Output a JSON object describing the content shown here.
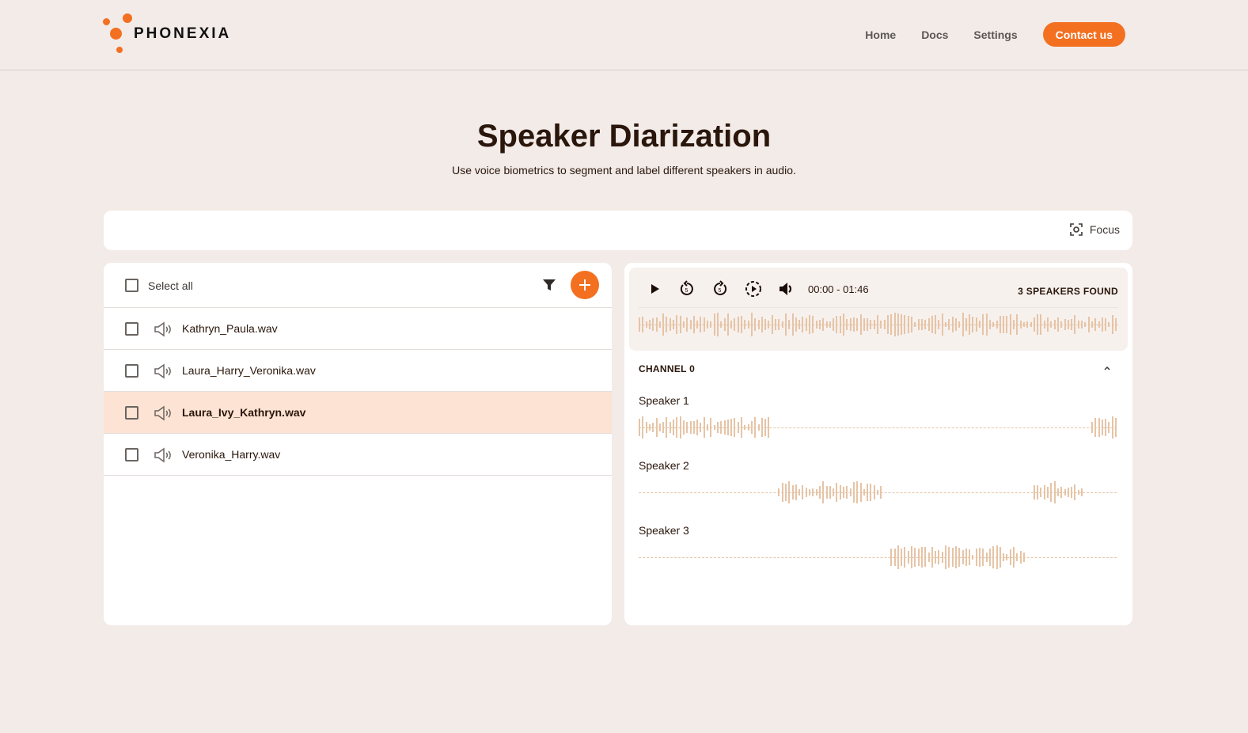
{
  "brand": {
    "name": "PHONEXIA",
    "accent": "#f37021"
  },
  "nav": {
    "items": [
      "Home",
      "Docs",
      "Settings"
    ],
    "contact": "Contact us"
  },
  "page": {
    "title": "Speaker Diarization",
    "subtitle": "Use voice biometrics to segment and label different speakers in audio."
  },
  "toolbar": {
    "focus_label": "Focus",
    "focus_icon": "focus-icon"
  },
  "files": {
    "select_all": "Select all",
    "items": [
      {
        "name": "Kathryn_Paula.wav",
        "selected": false
      },
      {
        "name": "Laura_Harry_Veronika.wav",
        "selected": false
      },
      {
        "name": "Laura_Ivy_Kathryn.wav",
        "selected": true
      },
      {
        "name": "Veronika_Harry.wav",
        "selected": false
      }
    ]
  },
  "player": {
    "time": "00:00 - 01:46",
    "speakers_found": "3 SPEAKERS FOUND",
    "channel": "CHANNEL 0",
    "speakers": [
      {
        "label": "Speaker 1",
        "segments": [
          [
            0.0,
            0.275
          ],
          [
            0.945,
            1.0
          ]
        ]
      },
      {
        "label": "Speaker 2",
        "segments": [
          [
            0.285,
            0.51
          ],
          [
            0.825,
            0.93
          ]
        ]
      },
      {
        "label": "Speaker 3",
        "segments": [
          [
            0.52,
            0.81
          ]
        ]
      }
    ],
    "wave_color": "#e6c4a6"
  }
}
